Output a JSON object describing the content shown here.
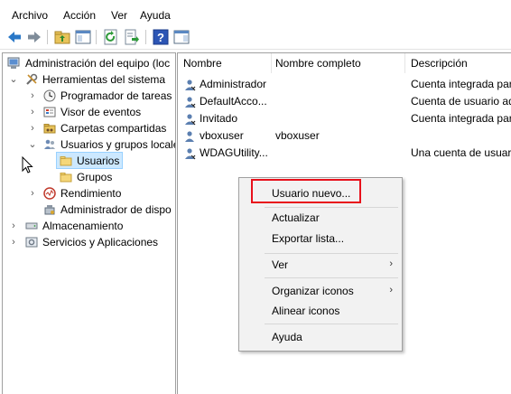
{
  "menubar": {
    "items": [
      "Archivo",
      "Acción",
      "Ver",
      "Ayuda"
    ]
  },
  "toolbar": {
    "icons": [
      "back-arrow-icon",
      "forward-arrow-icon",
      "up-folder-icon",
      "show-hide-tree-icon",
      "refresh-icon",
      "export-list-icon",
      "help-icon",
      "show-hide-action-pane-icon"
    ]
  },
  "tree": {
    "root": "Administración del equipo (loc",
    "system_tools": "Herramientas del sistema",
    "task_scheduler": "Programador de tareas",
    "event_viewer": "Visor de eventos",
    "shared_folders": "Carpetas compartidas",
    "local_users": "Usuarios y grupos locale",
    "users": "Usuarios",
    "groups": "Grupos",
    "performance": "Rendimiento",
    "device_manager": "Administrador de dispo",
    "storage": "Almacenamiento",
    "services": "Servicios y Aplicaciones"
  },
  "list": {
    "headers": [
      "Nombre",
      "Nombre completo",
      "Descripción"
    ],
    "rows": [
      {
        "name": "Administrador",
        "fullname": "",
        "description": "Cuenta integrada par"
      },
      {
        "name": "DefaultAcco...",
        "fullname": "",
        "description": "Cuenta de usuario ad"
      },
      {
        "name": "Invitado",
        "fullname": "",
        "description": "Cuenta integrada par"
      },
      {
        "name": "vboxuser",
        "fullname": "vboxuser",
        "description": ""
      },
      {
        "name": "WDAGUtility...",
        "fullname": "",
        "description": "Una cuenta de usuario"
      }
    ]
  },
  "context_menu": {
    "new_user": "Usuario nuevo...",
    "refresh": "Actualizar",
    "export": "Exportar lista...",
    "view": "Ver",
    "arrange_icons": "Organizar iconos",
    "line_up_icons": "Alinear iconos",
    "help": "Ayuda"
  }
}
